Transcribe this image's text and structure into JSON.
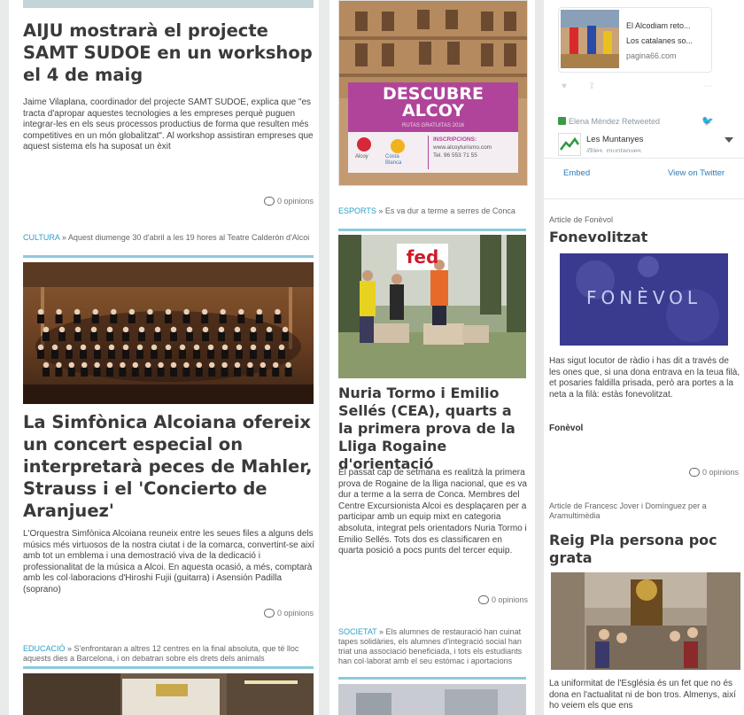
{
  "col1": {
    "article1": {
      "title": "AIJU mostrarà el projecte SAMT SUDOE en un workshop el 4 de maig",
      "body": "Jaime Vilaplana, coordinador del projecte SAMT SUDOE, explica que \"es tracta d'apropar aquestes tecnologies a les empreses perquè puguen integrar-les en els seus processos productius de forma que resulten més competitives en un món globalitzat\". Al workshop assistiran empreses que aquest sistema els ha suposat un èxit",
      "opinions": "0 opinions"
    },
    "article2": {
      "category": "CULTURA",
      "teaser": " » Aquest diumenge 30 d'abril a les 19 hores al Teatre Calderón d'Alcoi",
      "title": "La Simfònica Alcoiana ofereix un concert especial on interpretarà peces de Mahler, Strauss i el 'Concierto de Aranjuez'",
      "body": "L'Orquestra Simfònica Alcoiana reuneix entre les seues files a alguns dels músics més virtuosos de la nostra ciutat i de la comarca, convertint-se així amb tot un emblema i una demostració viva de la dedicació i professionalitat de la música a Alcoi. En aquesta ocasió, a més, comptarà amb les col·laboracions d'Hiroshi Fujii (guitarra) i Asensión Padilla (soprano)",
      "opinions": "0 opinions"
    },
    "article3": {
      "category": "EDUCACIÓ",
      "teaser": " » S'enfrontaran a altres 12 centres en la final absoluta, que té lloc aquests dies a Barcelona, i on debatran sobre els drets dels animals"
    }
  },
  "col2": {
    "ad": {
      "headline1": "DESCUBRE",
      "headline2": "ALCOY",
      "subline": "RUTAS GRATUITAS 2016",
      "logo1": "Alcoy",
      "logo2": "Costa Blanca",
      "inscriptions_label": "INSCRIPCIONS:",
      "web": "www.alcoyturismo.com",
      "phone": "Tel. 96 553 71 55"
    },
    "article1": {
      "category": "ESPORTS",
      "teaser": " » Es va dur a terme a serres de Conca",
      "banner_text": "fed",
      "title": "Nuria Tormo i Emilio Sellés (CEA), quarts a la primera prova de la Lliga Rogaine d'orientació",
      "body": "El passat cap de setmana es realitzà la primera prova de Rogaine de la lliga nacional, que es va dur a terme a la serra de Conca. Membres del Centre Excursionista Alcoi es desplaçaren per a participar amb un equip mixt en categoria absoluta, integrat pels orientadors Nuria Tormo i Emilio Sellés. Tots dos es classificaren en quarta posició a pocs punts del tercer equip.",
      "opinions": "0 opinions"
    },
    "article2": {
      "category": "SOCIETAT",
      "teaser": " » Els alumnes de restauració han cuinat tapes solidàries, els alumnes d'integració social han triat una associació beneficiada, i tots els estudiants han col·laborat amb el seu estómac i aportacions"
    }
  },
  "col3": {
    "twitter": {
      "card_line1": "El Alcodiam reto...",
      "card_line2": "Los catalanes so...",
      "card_domain": "pagina66.com",
      "retweet_line": "Elena Méndez Retweeted",
      "account_name": "Les Muntanyes",
      "account_handle": "@les_muntanyes",
      "embed": "Embed",
      "view": "View on Twitter"
    },
    "article1": {
      "kicker": "Article de Fonèvol",
      "title": "Fonevolitzat",
      "image_text": "FONÈVOL",
      "body": "Has sigut locutor de ràdio i has dit a través de les ones que, si una dona entrava en la teua filà, et posaries faldilla prisada, però ara portes a la neta a la filà: estàs fonevolitzat.",
      "author": "Fonèvol",
      "opinions": "0 opinions"
    },
    "article2": {
      "kicker": "Article de Francesc Jover i Domínguez per a Aramultimèdia",
      "title": "Reig Pla persona poc grata",
      "body": "La uniformitat de l'Església és un fet que no és dona en l'actualitat ni de bon tros. Almenys, així ho veiem els que ens"
    }
  },
  "colors": {
    "accent": "#2aa0c8",
    "rule": "#8fc9dc",
    "ad_purple": "#b0449a"
  }
}
